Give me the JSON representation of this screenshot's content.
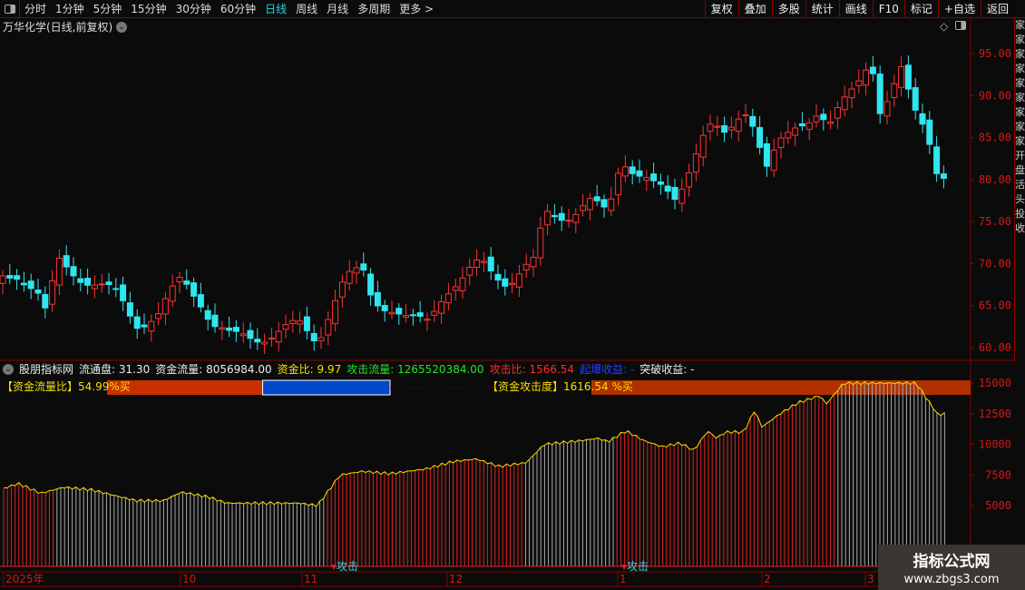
{
  "toolbar": {
    "periods": [
      "分时",
      "1分钟",
      "5分钟",
      "15分钟",
      "30分钟",
      "60分钟",
      "日线",
      "周线",
      "月线",
      "多周期",
      "更多 >"
    ],
    "active_period": "日线",
    "right_buttons": [
      "复权",
      "叠加",
      "多股",
      "统计",
      "画线",
      "F10",
      "标记",
      "+自选",
      "返回"
    ]
  },
  "main": {
    "title": "万华化学(日线,前复权)",
    "y_ticks": [
      "95.00",
      "90.00",
      "85.00",
      "80.00",
      "75.00",
      "70.00",
      "65.00",
      "60.00"
    ]
  },
  "indicator": {
    "source": "股朋指标网",
    "float_label": "流通盘:",
    "float_value": "31.30",
    "flow_label": "资金流量:",
    "flow_value": "8056984.00",
    "ratio_label": "资金比:",
    "ratio_value": "9.97",
    "attack_flow_label": "攻击流量:",
    "attack_flow_value": "1265520384.00",
    "attack_ratio_label": "攻击比:",
    "attack_ratio_value": "1566.54",
    "burst_label": "起爆收益:",
    "burst_value": "-",
    "break_label": "突破收益:",
    "break_value": "-",
    "bar1_label": "【资金流量比】54.99",
    "bar1_suffix": "%买",
    "bar1_percent": 54.99,
    "bar2_label": "【资金攻击度】1616.",
    "bar2_suffix": "54 %买",
    "signal_label": "攻击",
    "y_ticks": [
      "15000",
      "12500",
      "10000",
      "7500",
      "5000"
    ]
  },
  "x_axis": {
    "labels": [
      "2025年",
      "10",
      "11",
      "12",
      "1",
      "2",
      "3"
    ]
  },
  "side_tabs": "家家家家家家家家家开盘活头投收",
  "watermark": {
    "title": "指标公式网",
    "url": "www.zbgs3.com"
  },
  "colors": {
    "up": "#ff3232",
    "down": "#2ee6f0",
    "grid": "#8b0000",
    "line": "#f5e000"
  },
  "chart_data": {
    "type": "candlestick",
    "price_range": [
      60,
      95
    ],
    "close_keypoints": [
      [
        0,
        68
      ],
      [
        20,
        69
      ],
      [
        40,
        67
      ],
      [
        50,
        64
      ],
      [
        65,
        70
      ],
      [
        100,
        68
      ],
      [
        130,
        66
      ],
      [
        150,
        63
      ],
      [
        175,
        64
      ],
      [
        200,
        68
      ],
      [
        220,
        66
      ],
      [
        235,
        63
      ],
      [
        255,
        61
      ],
      [
        290,
        61.5
      ],
      [
        330,
        62.5
      ],
      [
        350,
        61
      ],
      [
        365,
        65
      ],
      [
        380,
        68
      ],
      [
        400,
        69
      ],
      [
        410,
        66
      ],
      [
        430,
        65
      ],
      [
        450,
        63
      ],
      [
        470,
        63
      ],
      [
        490,
        67
      ],
      [
        510,
        68
      ],
      [
        530,
        70
      ],
      [
        560,
        68
      ],
      [
        590,
        70
      ],
      [
        600,
        76
      ],
      [
        630,
        76
      ],
      [
        650,
        77
      ],
      [
        670,
        76
      ],
      [
        685,
        83
      ],
      [
        700,
        81
      ],
      [
        720,
        79
      ],
      [
        745,
        78
      ],
      [
        765,
        83
      ],
      [
        780,
        86
      ],
      [
        800,
        85
      ],
      [
        820,
        89
      ],
      [
        830,
        87
      ],
      [
        845,
        81
      ],
      [
        860,
        84
      ],
      [
        880,
        87
      ],
      [
        900,
        88
      ],
      [
        915,
        86
      ],
      [
        935,
        90
      ],
      [
        950,
        93
      ],
      [
        960,
        95
      ],
      [
        970,
        88
      ],
      [
        980,
        89
      ],
      [
        995,
        93
      ],
      [
        1005,
        89
      ],
      [
        1015,
        88
      ],
      [
        1025,
        85
      ],
      [
        1035,
        80
      ],
      [
        1042,
        80
      ]
    ],
    "indicator_keypoints": [
      [
        0,
        6300
      ],
      [
        20,
        6800
      ],
      [
        45,
        6000
      ],
      [
        70,
        6500
      ],
      [
        100,
        6300
      ],
      [
        150,
        5400
      ],
      [
        180,
        5400
      ],
      [
        200,
        6100
      ],
      [
        230,
        5700
      ],
      [
        250,
        5200
      ],
      [
        330,
        5200
      ],
      [
        350,
        5000
      ],
      [
        375,
        7500
      ],
      [
        400,
        7800
      ],
      [
        430,
        7600
      ],
      [
        470,
        8000
      ],
      [
        500,
        8600
      ],
      [
        525,
        8800
      ],
      [
        550,
        8200
      ],
      [
        580,
        8500
      ],
      [
        600,
        10000
      ],
      [
        640,
        10300
      ],
      [
        660,
        10500
      ],
      [
        670,
        10200
      ],
      [
        690,
        11100
      ],
      [
        710,
        10300
      ],
      [
        730,
        9800
      ],
      [
        750,
        10100
      ],
      [
        765,
        9500
      ],
      [
        780,
        11100
      ],
      [
        790,
        10500
      ],
      [
        800,
        11000
      ],
      [
        820,
        11000
      ],
      [
        832,
        12800
      ],
      [
        840,
        11400
      ],
      [
        860,
        12500
      ],
      [
        880,
        13400
      ],
      [
        905,
        14000
      ],
      [
        910,
        13200
      ],
      [
        930,
        15000
      ],
      [
        1010,
        15000
      ],
      [
        1035,
        12300
      ],
      [
        1042,
        12600
      ]
    ],
    "indicator_range": [
      0,
      15000
    ]
  }
}
